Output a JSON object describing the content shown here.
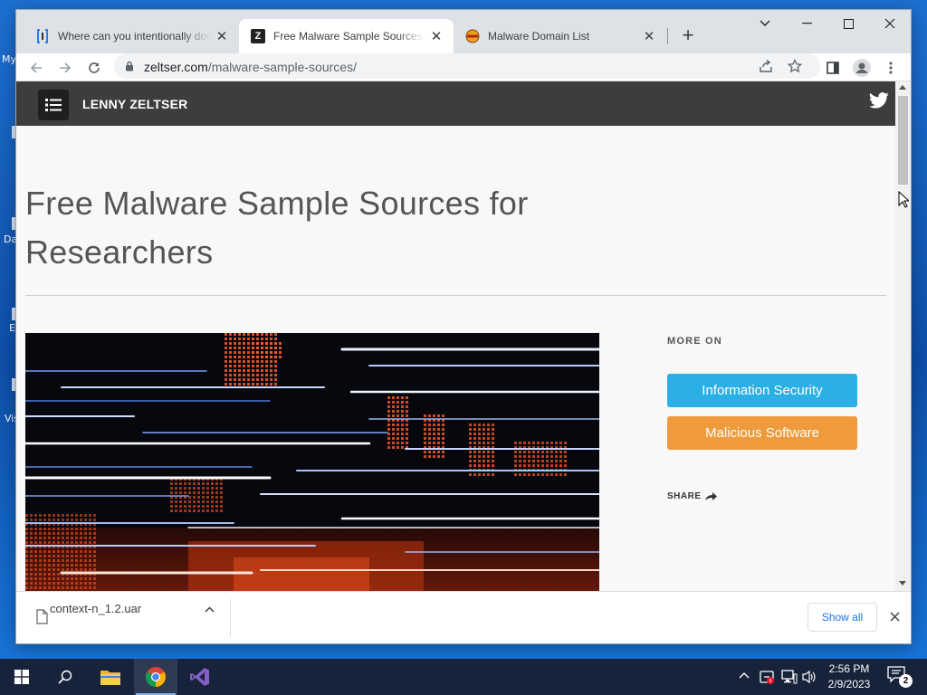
{
  "desktop": {
    "icon_labels": [
      "My",
      "Da",
      "E",
      "Vis"
    ]
  },
  "browser": {
    "tabs": [
      {
        "title": "Where can you intentionally dow",
        "favicon": "bracket-page-icon",
        "active": false
      },
      {
        "title": "Free Malware Sample Sources fo",
        "favicon": "zeltser-z-icon",
        "active": true
      },
      {
        "title": "Malware Domain List",
        "favicon": "malware-domain-list-icon",
        "active": false
      }
    ],
    "new_tab_label": "+",
    "address": {
      "host": "zeltser.com",
      "path": "/malware-sample-sources/"
    }
  },
  "site": {
    "name": "LENNY ZELTSER",
    "title": "Free Malware Sample Sources for Researchers",
    "sidebar": {
      "more_on": "MORE ON",
      "tags": [
        "Information Security",
        "Malicious Software"
      ],
      "share": "SHARE"
    },
    "colors": {
      "header": "#3d3d3d",
      "tag_blue": "#2bb0e5",
      "tag_orange": "#ef9a3c"
    }
  },
  "downloads": {
    "file_name": "context-n_1.2.uar",
    "show_all": "Show all"
  },
  "taskbar": {
    "time": "2:56 PM",
    "date": "2/9/2023",
    "notification_count": "2"
  }
}
